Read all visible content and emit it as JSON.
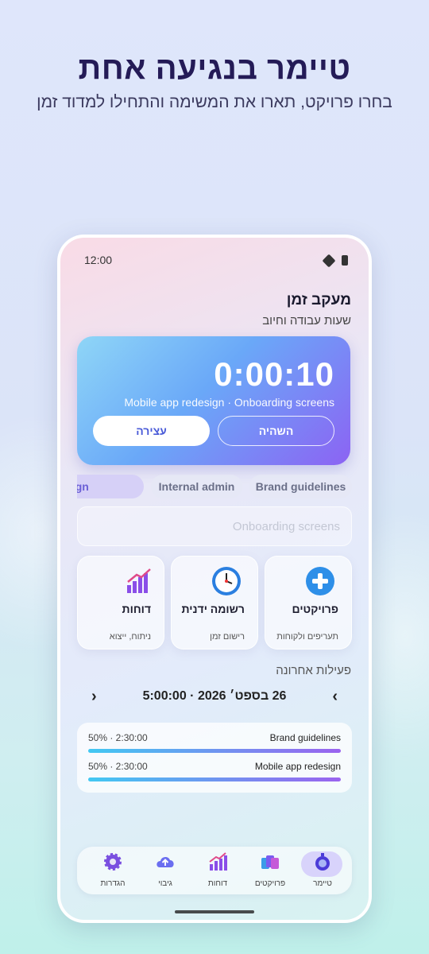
{
  "promo": {
    "headline": "טיימר בנגיעה אחת",
    "subtitle": "בחרו פרויקט, תארו את המשימה והתחילו למדוד זמן"
  },
  "status_bar": {
    "time": "12:00"
  },
  "header": {
    "title": "מעקב זמן",
    "subtitle": "שעות עבודה וחיוב"
  },
  "timer": {
    "value": "0:00:10",
    "task": "Mobile app redesign · Onboarding screens",
    "pause_label": "השהיה",
    "stop_label": "עצירה"
  },
  "project_chips": [
    "Brand guidelines",
    "Internal admin",
    "Mobile app redesign"
  ],
  "chip_visible": [
    "Brand guidelines",
    "Internal admin",
    "p redesign"
  ],
  "task_input": {
    "value": "",
    "placeholder": "Onboarding screens"
  },
  "tiles": [
    {
      "name": "פרויקטים",
      "sub": "תעריפים ולקוחות",
      "icon": "plus-icon"
    },
    {
      "name": "רשומה ידנית",
      "sub": "רישום זמן",
      "icon": "clock-icon"
    },
    {
      "name": "דוחות",
      "sub": "ניתוח, ייצוא",
      "icon": "bar-chart-icon"
    }
  ],
  "recent": {
    "title": "פעילות אחרונה",
    "date_label": "26 בספט׳ 2026  ·  5:00:00"
  },
  "activity": [
    {
      "name": "Brand guidelines",
      "meta": "50%  ·  2:30:00",
      "percent": 50
    },
    {
      "name": "Mobile app redesign",
      "meta": "50%  ·  2:30:00",
      "percent": 50
    }
  ],
  "nav": [
    {
      "label": "טיימר",
      "icon": "stopwatch-icon",
      "active": true
    },
    {
      "label": "פרויקטים",
      "icon": "folders-icon",
      "active": false
    },
    {
      "label": "דוחות",
      "icon": "reports-icon",
      "active": false
    },
    {
      "label": "גיבוי",
      "icon": "cloud-upload-icon",
      "active": false
    },
    {
      "label": "הגדרות",
      "icon": "gear-icon",
      "active": false
    }
  ],
  "colors": {
    "accent": "#7b5cf0",
    "headline": "#241b57"
  }
}
